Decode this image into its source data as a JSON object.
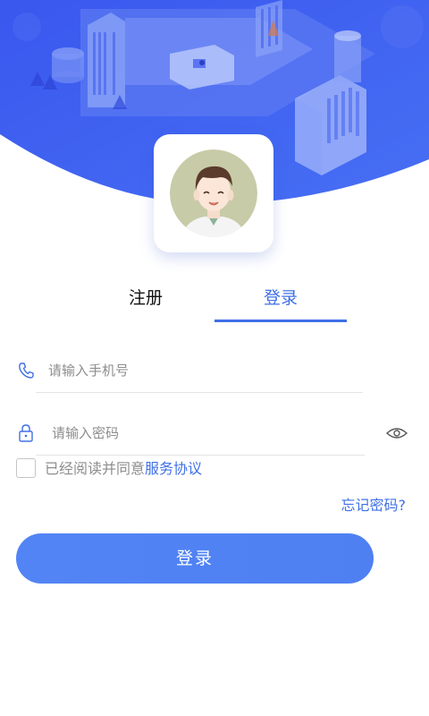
{
  "tabs": {
    "register_label": "注册",
    "login_label": "登录",
    "active": "login"
  },
  "phone_field": {
    "placeholder": "请输入手机号",
    "value": "",
    "icon": "phone-icon"
  },
  "password_field": {
    "placeholder": "请输入密码",
    "value": "",
    "icon": "lock-icon",
    "toggle_icon": "eye-icon"
  },
  "agreement": {
    "checked": false,
    "prefix": "已经阅读并同意",
    "link_label": "服务协议"
  },
  "forgot_password_label": "忘记密码?",
  "login_button_label": "登录",
  "colors": {
    "primary": "#3f70e6",
    "hero_blue": "#3d5df0",
    "button_blue": "#5284f5",
    "placeholder_gray": "#8d8d8d",
    "divider_gray": "#e4e4e4"
  }
}
